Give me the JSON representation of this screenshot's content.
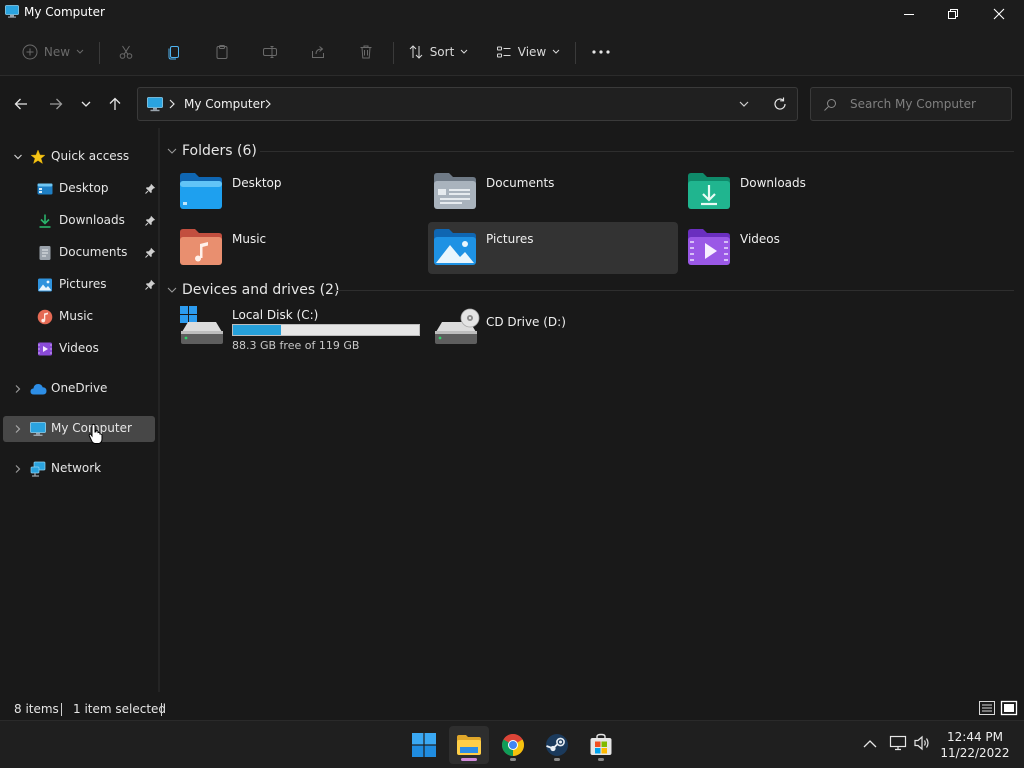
{
  "window": {
    "title": "My Computer"
  },
  "toolbar": {
    "new_label": "New",
    "sort_label": "Sort",
    "view_label": "View"
  },
  "address": {
    "crumb": "My Computer",
    "search_placeholder": "Search My Computer"
  },
  "sidebar": {
    "quick_access": "Quick access",
    "items": [
      {
        "label": "Desktop",
        "pinned": true
      },
      {
        "label": "Downloads",
        "pinned": true
      },
      {
        "label": "Documents",
        "pinned": true
      },
      {
        "label": "Pictures",
        "pinned": true
      },
      {
        "label": "Music",
        "pinned": false
      },
      {
        "label": "Videos",
        "pinned": false
      }
    ],
    "onedrive": "OneDrive",
    "mycomputer": "My Computer",
    "network": "Network"
  },
  "content": {
    "folders_header": "Folders (6)",
    "folders": [
      {
        "label": "Desktop"
      },
      {
        "label": "Documents"
      },
      {
        "label": "Downloads"
      },
      {
        "label": "Music"
      },
      {
        "label": "Pictures",
        "selected": true
      },
      {
        "label": "Videos"
      }
    ],
    "devices_header": "Devices and drives (2)",
    "drives": [
      {
        "label": "Local Disk (C:)",
        "free_text": "88.3 GB free of 119 GB",
        "used_fraction": 0.26
      },
      {
        "label": "CD Drive (D:)"
      }
    ]
  },
  "status": {
    "items": "8 items",
    "selected": "1 item selected"
  },
  "taskbar": {
    "time": "12:44 PM",
    "date": "11/22/2022"
  },
  "colors": {
    "accent": "#26a0da",
    "selected_tile": "#333333",
    "selected_nav": "#474747"
  }
}
